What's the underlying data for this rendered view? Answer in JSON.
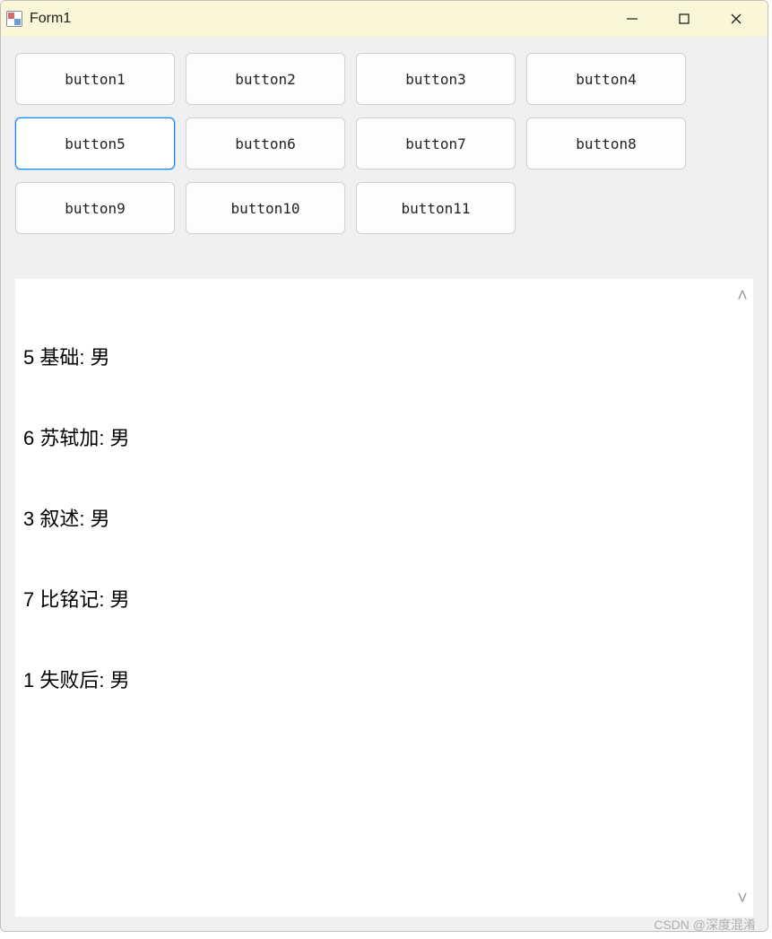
{
  "window": {
    "title": "Form1"
  },
  "buttons": [
    {
      "label": "button1",
      "focused": false
    },
    {
      "label": "button2",
      "focused": false
    },
    {
      "label": "button3",
      "focused": false
    },
    {
      "label": "button4",
      "focused": false
    },
    {
      "label": "button5",
      "focused": true
    },
    {
      "label": "button6",
      "focused": false
    },
    {
      "label": "button7",
      "focused": false
    },
    {
      "label": "button8",
      "focused": false
    },
    {
      "label": "button9",
      "focused": false
    },
    {
      "label": "button10",
      "focused": false
    },
    {
      "label": "button11",
      "focused": false
    }
  ],
  "output_lines": [
    "5 基础: 男",
    "6 苏轼加: 男",
    "3 叙述: 男",
    "7 比铭记: 男",
    "1 失败后: 男"
  ],
  "watermark": "CSDN @深度混淆"
}
